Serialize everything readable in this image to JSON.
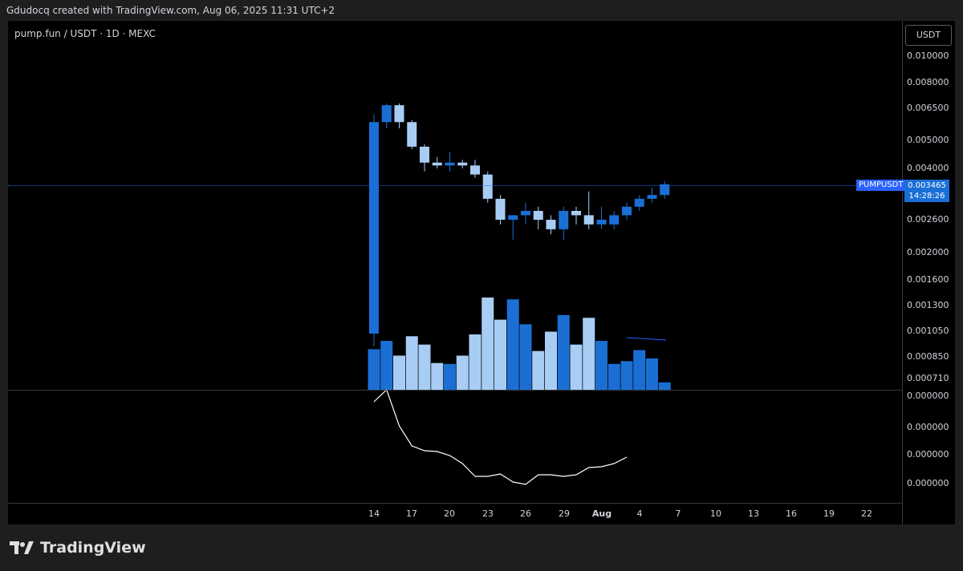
{
  "header": {
    "text": "Gdudocq created with TradingView.com, Aug 06, 2025 11:31 UTC+2"
  },
  "chart": {
    "pane_label": "pump.fun / USDT · 1D · MEXC",
    "currency_button": "USDT"
  },
  "price_axis": [
    "0.010000",
    "0.008000",
    "0.006500",
    "0.005000",
    "0.004000",
    "0.002600",
    "0.002000",
    "0.001600",
    "0.001300",
    "0.001050",
    "0.000850",
    "0.000710"
  ],
  "osc_axis": [
    "0.000000",
    "0.000000",
    "0.000000",
    "0.000000"
  ],
  "time_axis": [
    {
      "label": "14",
      "bold": false
    },
    {
      "label": "17",
      "bold": false
    },
    {
      "label": "20",
      "bold": false
    },
    {
      "label": "23",
      "bold": false
    },
    {
      "label": "26",
      "bold": false
    },
    {
      "label": "29",
      "bold": false
    },
    {
      "label": "Aug",
      "bold": true
    },
    {
      "label": "4",
      "bold": false
    },
    {
      "label": "7",
      "bold": false
    },
    {
      "label": "10",
      "bold": false
    },
    {
      "label": "13",
      "bold": false
    },
    {
      "label": "16",
      "bold": false
    },
    {
      "label": "19",
      "bold": false
    },
    {
      "label": "22",
      "bold": false
    }
  ],
  "last_price": {
    "symbol": "PUMPUSDT",
    "value": "0.003465",
    "countdown": "14:28:26"
  },
  "colors": {
    "up": "#1b6fd4",
    "down": "#a8cdf5",
    "osc_line": "#ffffff",
    "price_line": "#2962ff",
    "background": "#000000"
  },
  "chart_data": {
    "type": "candlestick",
    "x": [
      "Jul 14",
      "Jul 15",
      "Jul 16",
      "Jul 17",
      "Jul 18",
      "Jul 19",
      "Jul 20",
      "Jul 21",
      "Jul 22",
      "Jul 23",
      "Jul 24",
      "Jul 25",
      "Jul 26",
      "Jul 27",
      "Jul 28",
      "Jul 29",
      "Jul 30",
      "Jul 31",
      "Aug 1",
      "Aug 2",
      "Aug 3",
      "Aug 4",
      "Aug 5",
      "Aug 6"
    ],
    "ohlc": [
      [
        0.001,
        0.0063,
        0.0009,
        0.0059
      ],
      [
        0.0059,
        0.0069,
        0.0056,
        0.0068
      ],
      [
        0.0068,
        0.0069,
        0.0056,
        0.0059
      ],
      [
        0.0059,
        0.006,
        0.0047,
        0.0048
      ],
      [
        0.0048,
        0.0049,
        0.0039,
        0.0042
      ],
      [
        0.0042,
        0.0044,
        0.004,
        0.0041
      ],
      [
        0.0041,
        0.0046,
        0.0039,
        0.0042
      ],
      [
        0.0042,
        0.0043,
        0.004,
        0.0041
      ],
      [
        0.0041,
        0.0043,
        0.0037,
        0.0038
      ],
      [
        0.0038,
        0.0039,
        0.003,
        0.0031
      ],
      [
        0.0031,
        0.0032,
        0.0025,
        0.0026
      ],
      [
        0.0026,
        0.0027,
        0.0022,
        0.0027
      ],
      [
        0.0027,
        0.003,
        0.0025,
        0.0028
      ],
      [
        0.0028,
        0.0029,
        0.0024,
        0.0026
      ],
      [
        0.0026,
        0.0027,
        0.0023,
        0.0024
      ],
      [
        0.0024,
        0.0029,
        0.0022,
        0.0028
      ],
      [
        0.0028,
        0.0029,
        0.0025,
        0.0027
      ],
      [
        0.0027,
        0.0033,
        0.0024,
        0.0025
      ],
      [
        0.0025,
        0.0029,
        0.0024,
        0.0026
      ],
      [
        0.0025,
        0.0028,
        0.0024,
        0.0027
      ],
      [
        0.0027,
        0.003,
        0.0026,
        0.0029
      ],
      [
        0.0029,
        0.0032,
        0.0028,
        0.0031
      ],
      [
        0.0031,
        0.0034,
        0.003,
        0.0032
      ],
      [
        0.0032,
        0.0036,
        0.0031,
        0.0035
      ]
    ],
    "volume_relative": [
      0.44,
      0.53,
      0.37,
      0.58,
      0.49,
      0.29,
      0.28,
      0.37,
      0.6,
      1.0,
      0.76,
      0.98,
      0.71,
      0.42,
      0.63,
      0.81,
      0.49,
      0.78,
      0.53,
      0.28,
      0.31,
      0.43,
      0.34,
      0.08
    ],
    "oscillator_relative": [
      0.85,
      1.0,
      0.55,
      0.3,
      0.24,
      0.23,
      0.18,
      0.08,
      -0.08,
      -0.08,
      -0.05,
      -0.15,
      -0.18,
      -0.06,
      -0.06,
      -0.08,
      -0.06,
      0.03,
      0.04,
      0.08,
      0.16
    ],
    "ylabel": "USDT",
    "yscale": "log"
  }
}
